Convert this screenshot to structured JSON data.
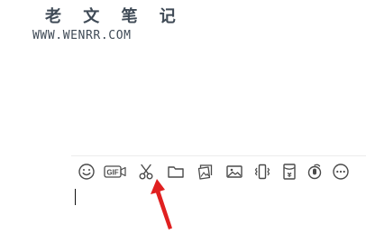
{
  "watermark": {
    "title": "老 文 笔 记",
    "url": "WWW.WENRR.COM"
  },
  "toolbar": {
    "items": [
      {
        "icon": "emoji-icon",
        "label": ""
      },
      {
        "icon": "gif-icon",
        "label": "GIF"
      },
      {
        "icon": "scissors-icon",
        "label": ""
      },
      {
        "icon": "folder-icon",
        "label": ""
      },
      {
        "icon": "image-gallery-icon",
        "label": ""
      },
      {
        "icon": "image-icon",
        "label": ""
      },
      {
        "icon": "shake-icon",
        "label": ""
      },
      {
        "icon": "red-packet-icon",
        "label": "¥"
      },
      {
        "icon": "voice-icon",
        "label": ""
      },
      {
        "icon": "more-icon",
        "label": ""
      }
    ]
  },
  "colors": {
    "icon": "#4a4a4a",
    "arrow": "#e02020",
    "divider": "#ececec",
    "watermark": "#3f4a56"
  }
}
